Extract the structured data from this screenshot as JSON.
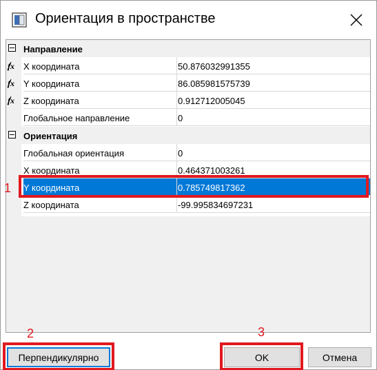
{
  "window": {
    "title": "Ориентация в пространстве"
  },
  "categories": [
    {
      "label": "Направление",
      "rows": [
        {
          "name": "X координата",
          "value": "50.876032991355",
          "icon": "fx-icon"
        },
        {
          "name": "Y координата",
          "value": "86.085981575739",
          "icon": "fx-icon"
        },
        {
          "name": "Z координата",
          "value": "0.912712005045",
          "icon": "fx-icon"
        },
        {
          "name": "Глобальное направление",
          "value": "0",
          "icon": ""
        }
      ]
    },
    {
      "label": "Ориентация",
      "rows": [
        {
          "name": "Глобальная ориентация",
          "value": "0"
        },
        {
          "name": "X координата",
          "value": "0.464371003261"
        },
        {
          "name": "Y координата",
          "value": "0.785749817362",
          "selected": true
        },
        {
          "name": "Z координата",
          "value": "-99.995834697231"
        }
      ]
    }
  ],
  "buttons": {
    "perpendicular": "Перпендикулярно",
    "ok": "OK",
    "cancel": "Отмена"
  },
  "annotations": {
    "n1": "1",
    "n2": "2",
    "n3": "3"
  },
  "colors": {
    "selection": "#0078d7",
    "annotation_red": "#e0191f"
  }
}
